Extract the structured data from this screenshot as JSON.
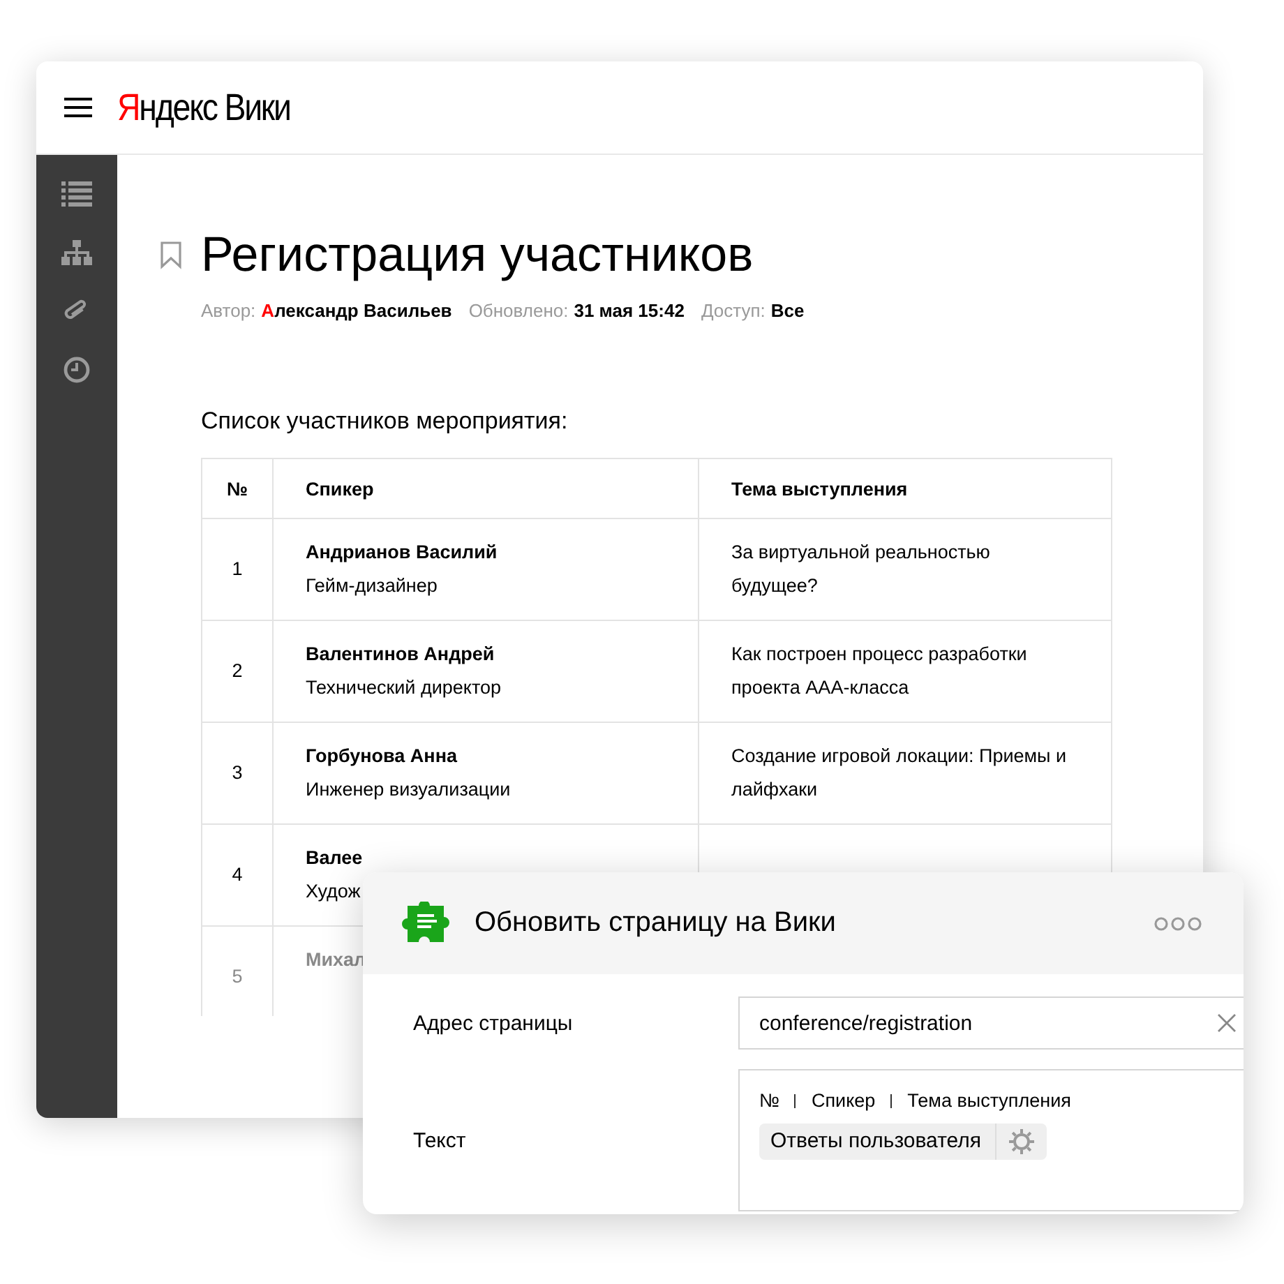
{
  "header": {
    "logo": "Яндекс Вики"
  },
  "page": {
    "title": "Регистрация участников",
    "meta": [
      {
        "label": "Автор:",
        "value": "Александр Васильев",
        "kind": "author"
      },
      {
        "label": "Обновлено:",
        "value": "31 мая 15:42"
      },
      {
        "label": "Доступ:",
        "value": "Все"
      }
    ],
    "intro": "Список участников мероприятия:",
    "table": {
      "columns": [
        "№",
        "Спикер",
        "Тема выступления"
      ],
      "rows": [
        {
          "number": "1",
          "name": "Андрианов Василий",
          "role": "Гейм-дизайнер",
          "topic": "За виртуальной реальностью будущее?",
          "faded": false
        },
        {
          "number": "2",
          "name": "Валентинов Андрей",
          "role": "Технический директор",
          "topic": "Как построен процесс разработки проекта ААА-класса",
          "faded": false
        },
        {
          "number": "3",
          "name": "Горбунова Анна",
          "role": "Инженер визуализации",
          "topic": "Создание игровой локации: Приемы и лайфхаки",
          "faded": false
        },
        {
          "number": "4",
          "name": "Валее",
          "role": "Худож",
          "faded": false
        },
        {
          "number": "5",
          "name": "Михал",
          "faded": true
        }
      ]
    }
  },
  "card": {
    "title": "Обновить страницу на Вики",
    "fields": [
      {
        "label": "Адрес страницы",
        "kind": "input",
        "value": "conference/registration"
      },
      {
        "label": "Текст",
        "kind": "text",
        "parts": [
          "№",
          "Спикер",
          "Тема выступления"
        ],
        "chip": "Ответы пользователя"
      }
    ]
  }
}
